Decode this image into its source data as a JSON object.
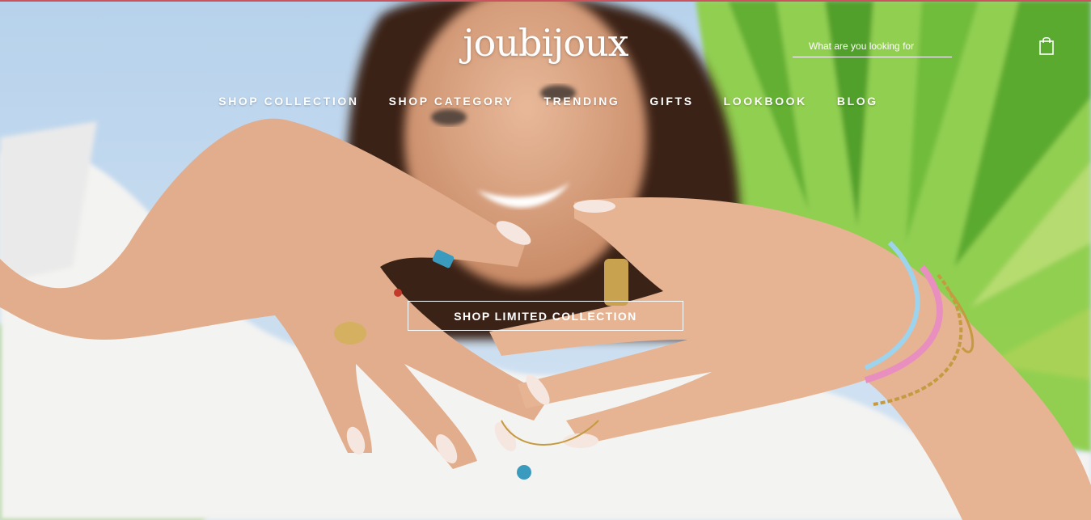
{
  "header": {
    "logo_text": "joubijoux",
    "search": {
      "placeholder": "What are you looking for"
    },
    "cart_icon": "shopping-bag-icon"
  },
  "nav": {
    "items": [
      {
        "label": "SHOP COLLECTION"
      },
      {
        "label": "SHOP CATEGORY"
      },
      {
        "label": "TRENDING"
      },
      {
        "label": "GIFTS"
      },
      {
        "label": "LOOKBOOK"
      },
      {
        "label": "BLOG"
      }
    ]
  },
  "hero": {
    "cta_label": "SHOP LIMITED COLLECTION"
  },
  "colors": {
    "sky": "#bcd6ee",
    "palm": "#7fc23a",
    "skin": "#e2b08f",
    "shirt": "#f4f4f2",
    "accent_line": "#c9545d",
    "text": "#ffffff"
  }
}
